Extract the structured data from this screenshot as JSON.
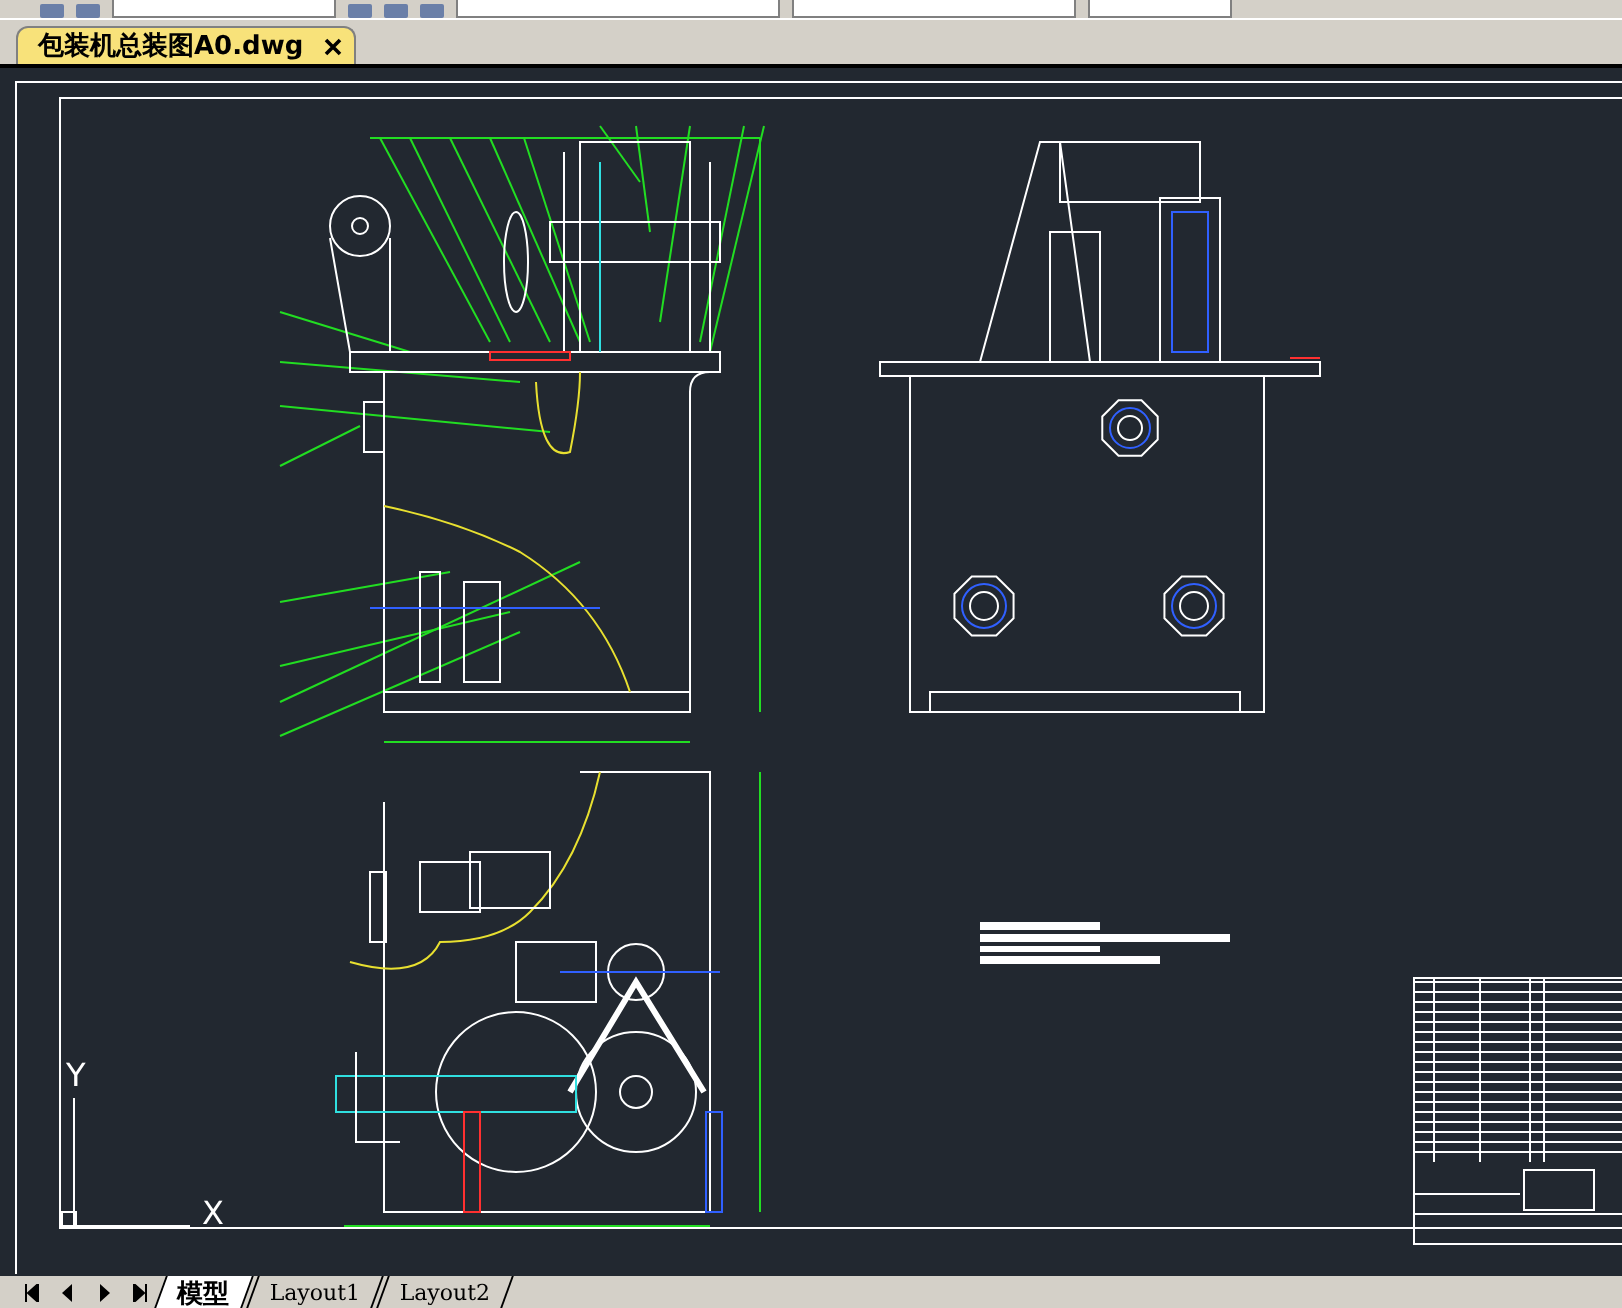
{
  "document_tab": {
    "title": "包装机总装图A0.dwg",
    "selected": true
  },
  "ucs_icon": {
    "x_label": "X",
    "y_label": "Y"
  },
  "layout_tabs": [
    {
      "label": "模型",
      "selected": true
    },
    {
      "label": "Layout1",
      "selected": false
    },
    {
      "label": "Layout2",
      "selected": false
    }
  ]
}
